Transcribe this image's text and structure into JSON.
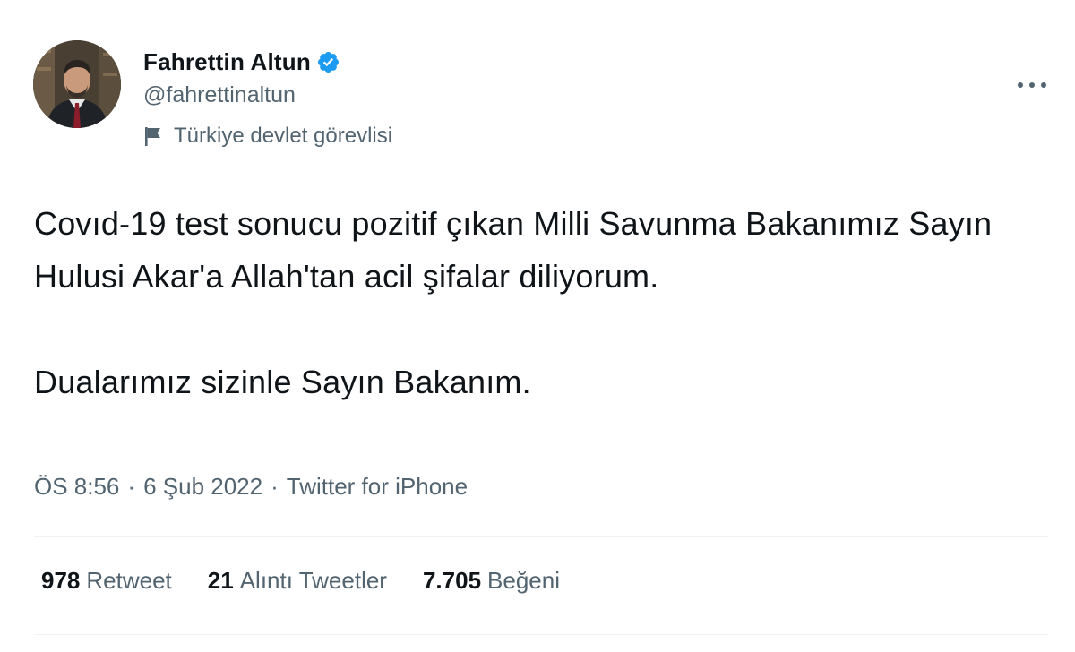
{
  "author": {
    "display_name": "Fahrettin Altun",
    "handle": "@fahrettinaltun",
    "verified_icon": "verified-badge-icon",
    "label_icon": "flag-icon",
    "label": "Türkiye devlet görevlisi"
  },
  "more_icon": "more-horizontal-icon",
  "tweet": {
    "text_paragraph_1": "Covıd-19 test sonucu pozitif çıkan Milli Savunma Bakanımız Sayın Hulusi Akar'a Allah'tan acil şifalar diliyorum.",
    "text_paragraph_2": "Dualarımız sizinle Sayın Bakanım.",
    "time": "ÖS 8:56",
    "date": "6 Şub 2022",
    "separator": "·",
    "source": "Twitter for iPhone"
  },
  "stats": [
    {
      "count": "978",
      "label": "Retweet"
    },
    {
      "count": "21",
      "label": "Alıntı Tweetler"
    },
    {
      "count": "7.705",
      "label": "Beğeni"
    }
  ],
  "colors": {
    "text_primary": "#0f1419",
    "text_secondary": "#536471",
    "verified_blue": "#1d9bf0",
    "divider": "#eff3f4"
  }
}
